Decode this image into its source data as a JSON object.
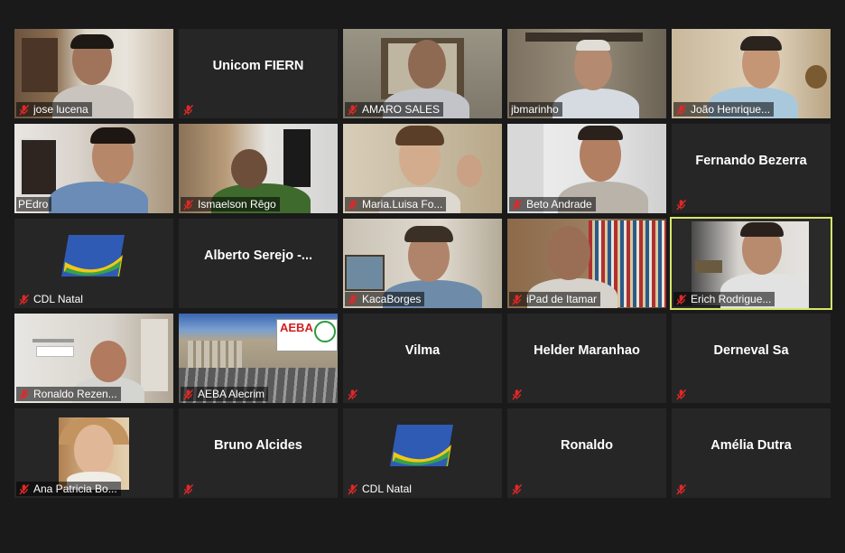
{
  "participants": [
    {
      "name": "jose lucena",
      "center_name": "",
      "muted": true
    },
    {
      "name": "",
      "center_name": "Unicom FIERN",
      "muted": true
    },
    {
      "name": "AMARO SALES",
      "center_name": "",
      "muted": true
    },
    {
      "name": "jbmarinho",
      "center_name": "",
      "muted": false
    },
    {
      "name": "João Henrique...",
      "center_name": "",
      "muted": true
    },
    {
      "name": "PEdro",
      "center_name": "",
      "muted": false
    },
    {
      "name": "Ismaelson Rêgo",
      "center_name": "",
      "muted": true
    },
    {
      "name": "Maria.Luisa Fo...",
      "center_name": "",
      "muted": true
    },
    {
      "name": "Beto Andrade",
      "center_name": "",
      "muted": true
    },
    {
      "name": "",
      "center_name": "Fernando Bezerra",
      "muted": true
    },
    {
      "name": "CDL Natal",
      "center_name": "",
      "muted": true
    },
    {
      "name": "",
      "center_name": "Alberto Serejo -...",
      "muted": false
    },
    {
      "name": "KacaBorges",
      "center_name": "",
      "muted": true
    },
    {
      "name": "iPad de Itamar",
      "center_name": "",
      "muted": true
    },
    {
      "name": "Erich Rodrigue...",
      "center_name": "",
      "muted": true,
      "active_speaker": true
    },
    {
      "name": "Ronaldo Rezen...",
      "center_name": "",
      "muted": true
    },
    {
      "name": "AEBA Alecrim",
      "center_name": "",
      "muted": true
    },
    {
      "name": "",
      "center_name": "Vilma",
      "muted": true
    },
    {
      "name": "",
      "center_name": "Helder Maranhao",
      "muted": true
    },
    {
      "name": "",
      "center_name": "Derneval Sa",
      "muted": true
    },
    {
      "name": "Ana Patricia Bo...",
      "center_name": "",
      "muted": true
    },
    {
      "name": "",
      "center_name": "Bruno Alcides",
      "muted": true
    },
    {
      "name": "CDL Natal",
      "center_name": "",
      "muted": true
    },
    {
      "name": "",
      "center_name": "Ronaldo",
      "muted": true
    },
    {
      "name": "",
      "center_name": "Amélia Dutra",
      "muted": true
    }
  ],
  "aeba_logo_text": "AEBA",
  "icons": {
    "muted": "mic-muted-icon",
    "cdl_logo": "cdl-natal-logo"
  },
  "colors": {
    "background": "#1a1a1a",
    "tile": "#262626",
    "speaker_outline": "#d7e66a",
    "mute_red": "#e02828"
  }
}
